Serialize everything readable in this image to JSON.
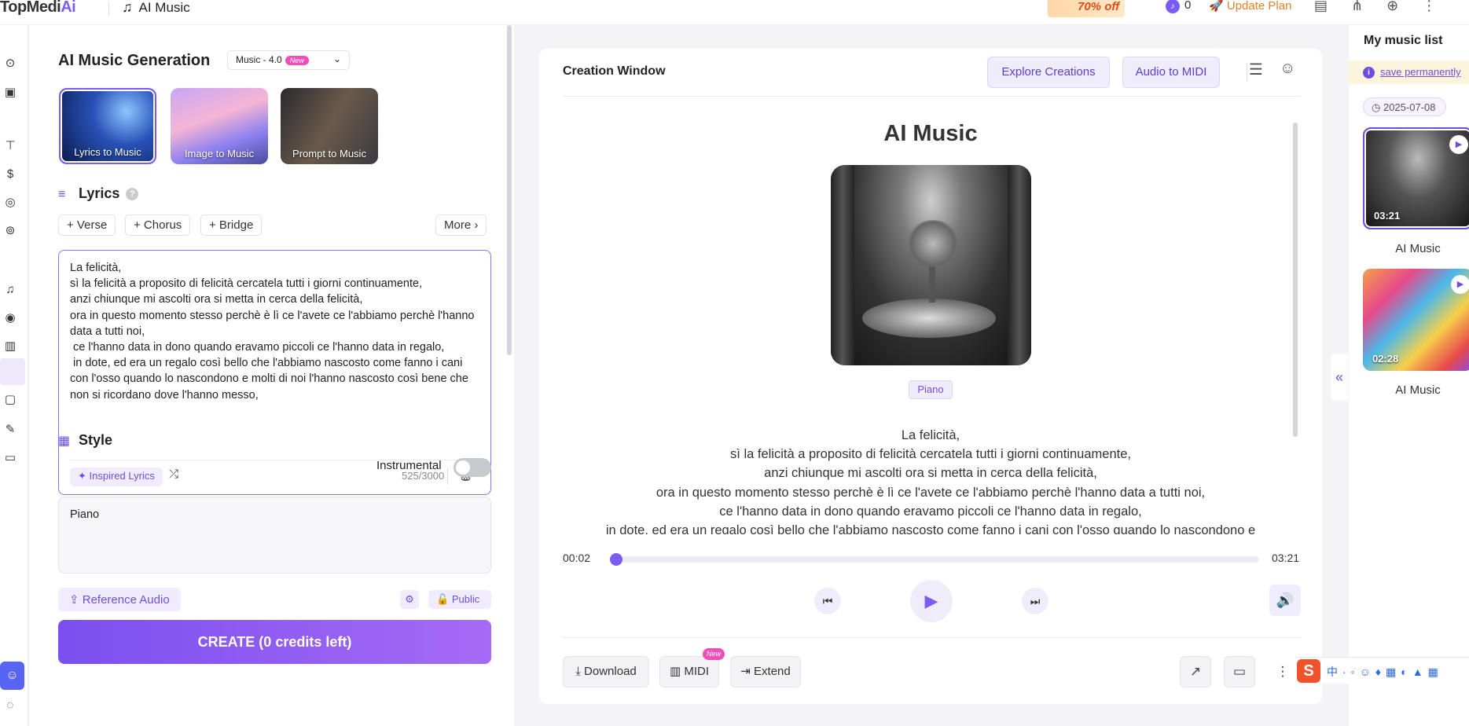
{
  "app": {
    "logo_text": "TopMedi",
    "logo_ai": "Ai",
    "page_title": "AI Music",
    "promo": "70% off",
    "credits": "0",
    "update_plan": "Update Plan"
  },
  "left_panel": {
    "title": "AI Music Generation",
    "version": "Music - 4.0",
    "version_badge": "New",
    "modes": [
      {
        "label": "Lyrics to Music",
        "selected": true
      },
      {
        "label": "Image to Music",
        "selected": false
      },
      {
        "label": "Prompt to Music",
        "selected": false
      }
    ],
    "lyrics_heading": "Lyrics",
    "chips": [
      "+ Verse",
      "+ Chorus",
      "+ Bridge"
    ],
    "more": "More",
    "lyrics_text": "La felicità,\nsì la felicità a proposito di felicità cercatela tutti i giorni continuamente,\nanzi chiunque mi ascolti ora si metta in cerca della felicità,\nora in questo momento stesso perchè è lì ce l'avete ce l'abbiamo perchè l'hanno data a tutti noi,\n ce l'hanno data in dono quando eravamo piccoli ce l'hanno data in regalo,\n in dote, ed era un regalo così bello che l'abbiamo nascosto come fanno i cani con l'osso quando lo nascondono e molti di noi l'hanno nascosto così bene che non si ricordano dove l'hanno messo,",
    "inspired_lyrics": "Inspired Lyrics",
    "char_count": "525/3000",
    "style_heading": "Style",
    "instrumental_label": "Instrumental",
    "style_text": "Piano",
    "reference_audio": "Reference Audio",
    "public_label": "Public",
    "create_button": "CREATE (0 credits left)"
  },
  "creation_window": {
    "title": "Creation Window",
    "explore_btn": "Explore Creations",
    "midi_btn": "Audio to MIDI",
    "song_title": "AI Music",
    "style_tag": "Piano",
    "lyrics_lines": [
      "La felicità,",
      "sì la felicità a proposito di felicità cercatela tutti i giorni continuamente,",
      "anzi chiunque mi ascolti ora si metta in cerca della felicità,",
      "ora in questo momento stesso perchè è lì ce l'avete ce l'abbiamo perchè l'hanno data a tutti noi,",
      "ce l'hanno data in dono quando eravamo piccoli ce l'hanno data in regalo,",
      "in dote, ed era un regalo così bello che l'abbiamo nascosto come fanno i cani con l'osso quando lo nascondono e"
    ],
    "current_time": "00:02",
    "total_time": "03:21",
    "progress": 0.01,
    "download": "Download",
    "midi": "MIDI",
    "midi_badge": "New",
    "extend": "Extend"
  },
  "music_list": {
    "title": "My music list",
    "save_notice": "save permanently",
    "date": "2025-07-08",
    "items": [
      {
        "name": "AI Music",
        "duration": "03:21",
        "selected": true
      },
      {
        "name": "AI Music",
        "duration": "02:28",
        "selected": false
      }
    ]
  },
  "colors": {
    "accent": "#7b5cf0",
    "accent_light": "#efecfc",
    "badge_pink": "#f04fb8"
  }
}
